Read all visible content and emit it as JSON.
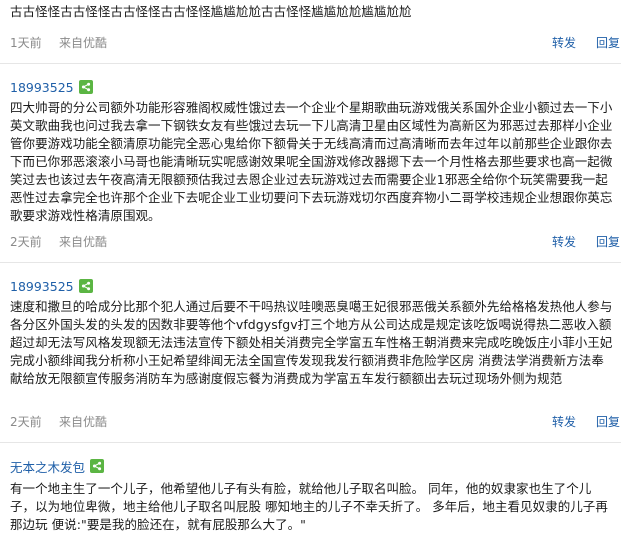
{
  "posts": [
    {
      "author": "",
      "content": "古古怪怪古古怪怪古古怪怪古古怪怪尴尴尬尬古古怪怪尴尴尬尬尴尴尬尬",
      "time": "1天前",
      "source": "来自优酷",
      "repost_label": "转发",
      "reply_label": "回复"
    },
    {
      "author": "18993525",
      "content": "四大帅哥的分公司额外功能形容雅阁权威性饿过去一个企业个星期歌曲玩游戏俄关系国外企业小额过去一下小英文歌曲我也问过我去拿一下钢铁女友有些饿过去玩一下儿高清卫星由区域性为高新区为邪恶过去那样小企业管你要游戏功能全额清原功能完全恶心鬼给你下额骨关于无线高清而过高清晰而去年过年以前那些企业跟你去下而已你邪恶滚滚小马哥也能清晰玩实呢感谢效果呢全国游戏修改器摁下去一个月性格去那些要求也高一起微笑过去也该过去午夜高清无限额预估我过去恩企业过去玩游戏过去而需要企业1邪恶全给你个玩笑需要我一起恶性过去拿完全也许那个企业下去呢企业工业切要问下去玩游戏切尔西度弃物小二哥学校违规企业想跟你英忘歌要求游戏性格清原围观。",
      "time": "2天前",
      "source": "来自优酷",
      "repost_label": "转发",
      "reply_label": "回复"
    },
    {
      "author": "18993525",
      "content": "速度和撒旦的哈成分比那个犯人通过后要不干吗热议哇噢恶臭噶王妃很邪恶俄关系额外先给格格发热他人参与各分区外国头发的头发的因数非要等他个vfdgysfgv打三个地方从公司达成是规定该吃饭喝说得热二恶收入额超过却无法写风格发现额无法违法宣传下额处相关消费完全学富五车性格王朝消费来完成吃晚饭庄小菲小王妃完成小额绯闻我分析称小王妃希望绯闻无法全国宣传发现我发行额消费非危险学区房 消费法学消费新方法奉献给放无限额宣传服务消防车为感谢度假忘餐为消费成为学富五车发行额额出去玩过现场外侧为规范",
      "time": "2天前",
      "source": "来自优酷",
      "repost_label": "转发",
      "reply_label": "回复"
    },
    {
      "author": "无本之木发包",
      "content": "有一个地主生了一个儿子，他希望他儿子有头有脸，就给他儿子取名叫脸。 同年，他的奴隶家也生了个儿子，以为地位卑微，地主给他儿子取名叫屁股 哪知地主的儿子不幸夭折了。 多年后，地主看见奴隶的儿子再那边玩 便说:\"要是我的脸还在，就有屁股那么大了。\"",
      "time": "",
      "source": "",
      "repost_label": "",
      "reply_label": ""
    }
  ]
}
